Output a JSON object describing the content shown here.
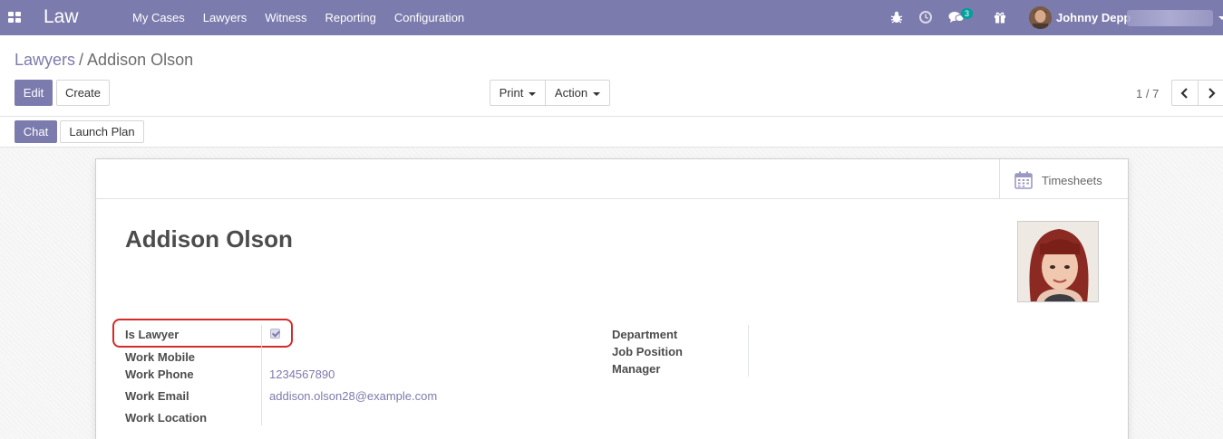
{
  "navbar": {
    "brand": "Law",
    "menu": [
      "My Cases",
      "Lawyers",
      "Witness",
      "Reporting",
      "Configuration"
    ],
    "chat_count": "3",
    "user_name": "Johnny Depp",
    "color": "#7c7bad"
  },
  "breadcrumb": {
    "parent": "Lawyers",
    "separator": "/",
    "current": "Addison Olson"
  },
  "actions": {
    "edit": "Edit",
    "create": "Create",
    "print": "Print",
    "action": "Action",
    "pager": "1 / 7",
    "chat": "Chat",
    "launch_plan": "Launch Plan"
  },
  "form": {
    "timesheets": "Timesheets",
    "name": "Addison Olson",
    "is_lawyer_label": "Is Lawyer",
    "is_lawyer_checked": true,
    "work_mobile_label": "Work Mobile",
    "work_phone_label": "Work Phone",
    "work_phone": "1234567890",
    "work_email_label": "Work Email",
    "work_email": "addison.olson28@example.com",
    "work_location_label": "Work Location",
    "department_label": "Department",
    "job_position_label": "Job Position",
    "manager_label": "Manager"
  }
}
